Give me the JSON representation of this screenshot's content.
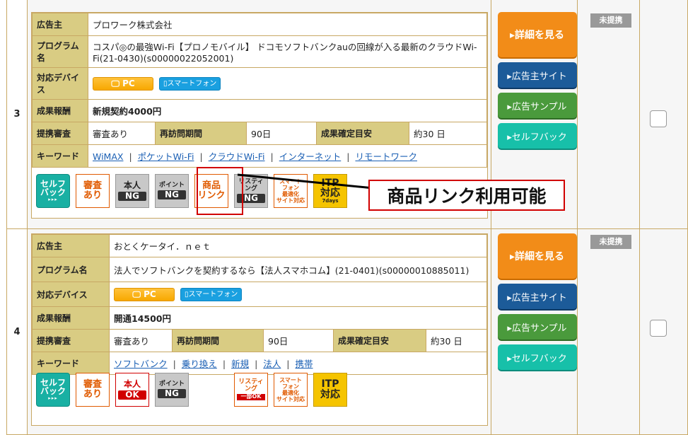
{
  "labels": {
    "advertiser": "広告主",
    "program": "プログラム名",
    "devices": "対応デバイス",
    "reward": "成果報酬",
    "review": "提携審査",
    "revisit": "再訪問期間",
    "confirm": "成果確定目安",
    "keywords": "キーワード"
  },
  "badges": {
    "pc": "PC",
    "smartphone": "スマートフォン"
  },
  "buttons": {
    "details": "▸詳細を見る",
    "advertiser_site": "▸広告主サイト",
    "ad_sample": "▸広告サンプル",
    "self_back": "▸セルフバック"
  },
  "status": "未提携",
  "icons": {
    "self_back": [
      "セルフ",
      "バック",
      "▸▸▸"
    ],
    "review": [
      "審査",
      "あり"
    ],
    "identity": "本人",
    "point": "ポイント",
    "ng": "NG",
    "ok": "OK",
    "product_link": [
      "商品",
      "リンク"
    ],
    "listing": [
      "リスティ",
      "ング"
    ],
    "listing_partial": "一部OK",
    "smartphone_opt": [
      "スマート",
      "フォン",
      "最適化",
      "サイト対応"
    ],
    "itp": [
      "ITP",
      "対応"
    ],
    "itp_days": "7days"
  },
  "annotation": "商品リンク利用可能",
  "rows": [
    {
      "num": "3",
      "advertiser": "プロワーク株式会社",
      "program": "コスパ◎の最強Wi-Fi【プロノモバイル】 ドコモソフトバンクauの回線が入る最新のクラウドWi-Fi(21-0430)(s00000022052001)",
      "reward": "新規契約4000円",
      "review": "審査あり",
      "revisit": "90日",
      "confirm": "約30 日",
      "keywords": [
        "WiMAX",
        "ポケットWi-Fi",
        "クラウドWi-Fi",
        "インターネット",
        "リモートワーク"
      ]
    },
    {
      "num": "4",
      "advertiser": "おとくケータイ．ｎｅｔ",
      "program": "法人でソフトバンクを契約するなら【法人スマホコム】(21-0401)(s00000010885011)",
      "reward": "開通14500円",
      "review": "審査あり",
      "revisit": "90日",
      "confirm": "約30 日",
      "keywords": [
        "ソフトバンク",
        "乗り換え",
        "新規",
        "法人",
        "携帯"
      ]
    }
  ]
}
